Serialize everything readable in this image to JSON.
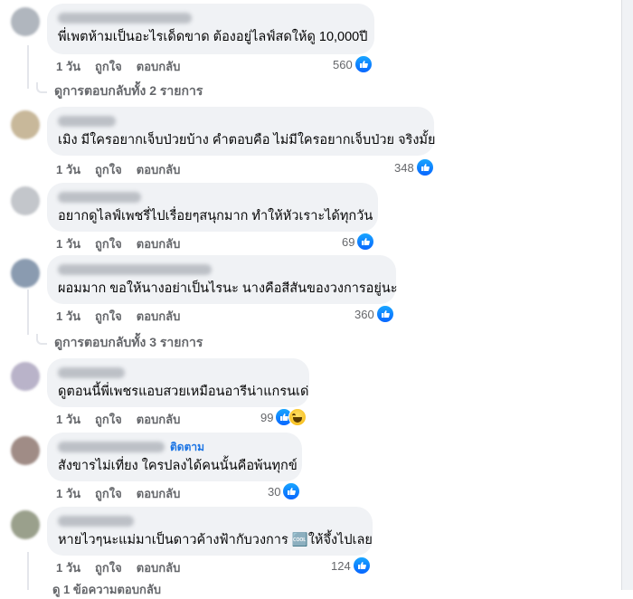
{
  "actions": {
    "like": "ถูกใจ",
    "reply": "ตอบกลับ"
  },
  "comments": [
    {
      "text": "พี่เพตห้ามเป็นอะไรเด็ดขาด ต้องอยู่ไลฟ์สดให้ดู 10,000ปี",
      "time": "1 วัน",
      "reactions": "560",
      "follow": ""
    },
    {
      "text": "เมิง มีใครอยากเจ็บป่วยบ้าง คำตอบคือ ไม่มีใครอยากเจ็บป่วย จริงมั้ย",
      "time": "1 วัน",
      "reactions": "348",
      "follow": ""
    },
    {
      "text": "อยากดูไลฟ์เพชรี่ไปเรื่อยๆสนุกมาก ทำให้หัวเราะได้ทุกวัน",
      "time": "1 วัน",
      "reactions": "69",
      "follow": ""
    },
    {
      "text": "ผอมมาก ขอให้นางอย่าเป็นไรนะ นางคือสีสันของวงการอยู่นะ",
      "time": "1 วัน",
      "reactions": "360",
      "follow": ""
    },
    {
      "text": "ดูตอนนี้พี่เพชรแอบสวยเหมือนอารีน่าแกรนเด่",
      "time": "1 วัน",
      "reactions": "99",
      "follow": ""
    },
    {
      "text": "สังขารไม่เที่ยง ใครปลงได้คนนั้นคือพ้นทุกข์",
      "time": "1 วัน",
      "reactions": "30",
      "follow": "ติดตาม"
    },
    {
      "text": "หายไวๆนะแม่มาเป็นดาวค้างฟ้ากับวงการ 🆒ให้จึ้งไปเลย",
      "time": "1 วัน",
      "reactions": "124",
      "follow": ""
    }
  ],
  "view_replies": [
    "ดูการตอบกลับทั้ง 2 รายการ",
    "ดูการตอบกลับทั้ง 3 รายการ"
  ],
  "footer_cut": "ดู 1 ข้อความตอบกลับ",
  "colors": {
    "bubble": "#f0f2f5",
    "meta": "#65676b",
    "link": "#1b74e4",
    "like": "#0866ff"
  }
}
